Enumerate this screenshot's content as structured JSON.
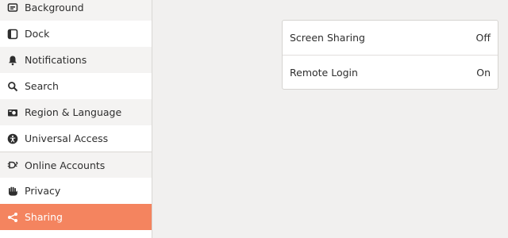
{
  "sidebar": {
    "items": [
      {
        "label": "Background",
        "icon": "background-icon"
      },
      {
        "label": "Dock",
        "icon": "dock-icon"
      },
      {
        "label": "Notifications",
        "icon": "bell-icon"
      },
      {
        "label": "Search",
        "icon": "search-icon"
      },
      {
        "label": "Region & Language",
        "icon": "region-language-icon"
      },
      {
        "label": "Universal Access",
        "icon": "universal-access-icon"
      },
      {
        "label": "Online Accounts",
        "icon": "online-accounts-icon"
      },
      {
        "label": "Privacy",
        "icon": "privacy-hand-icon"
      },
      {
        "label": "Sharing",
        "icon": "share-icon",
        "active": true
      }
    ]
  },
  "sharing": {
    "rows": [
      {
        "label": "Screen Sharing",
        "status": "Off"
      },
      {
        "label": "Remote Login",
        "status": "On"
      }
    ]
  },
  "colors": {
    "accent": "#f4845f",
    "sidebar_bg": "#ffffff",
    "content_bg": "#f1f0ef"
  }
}
